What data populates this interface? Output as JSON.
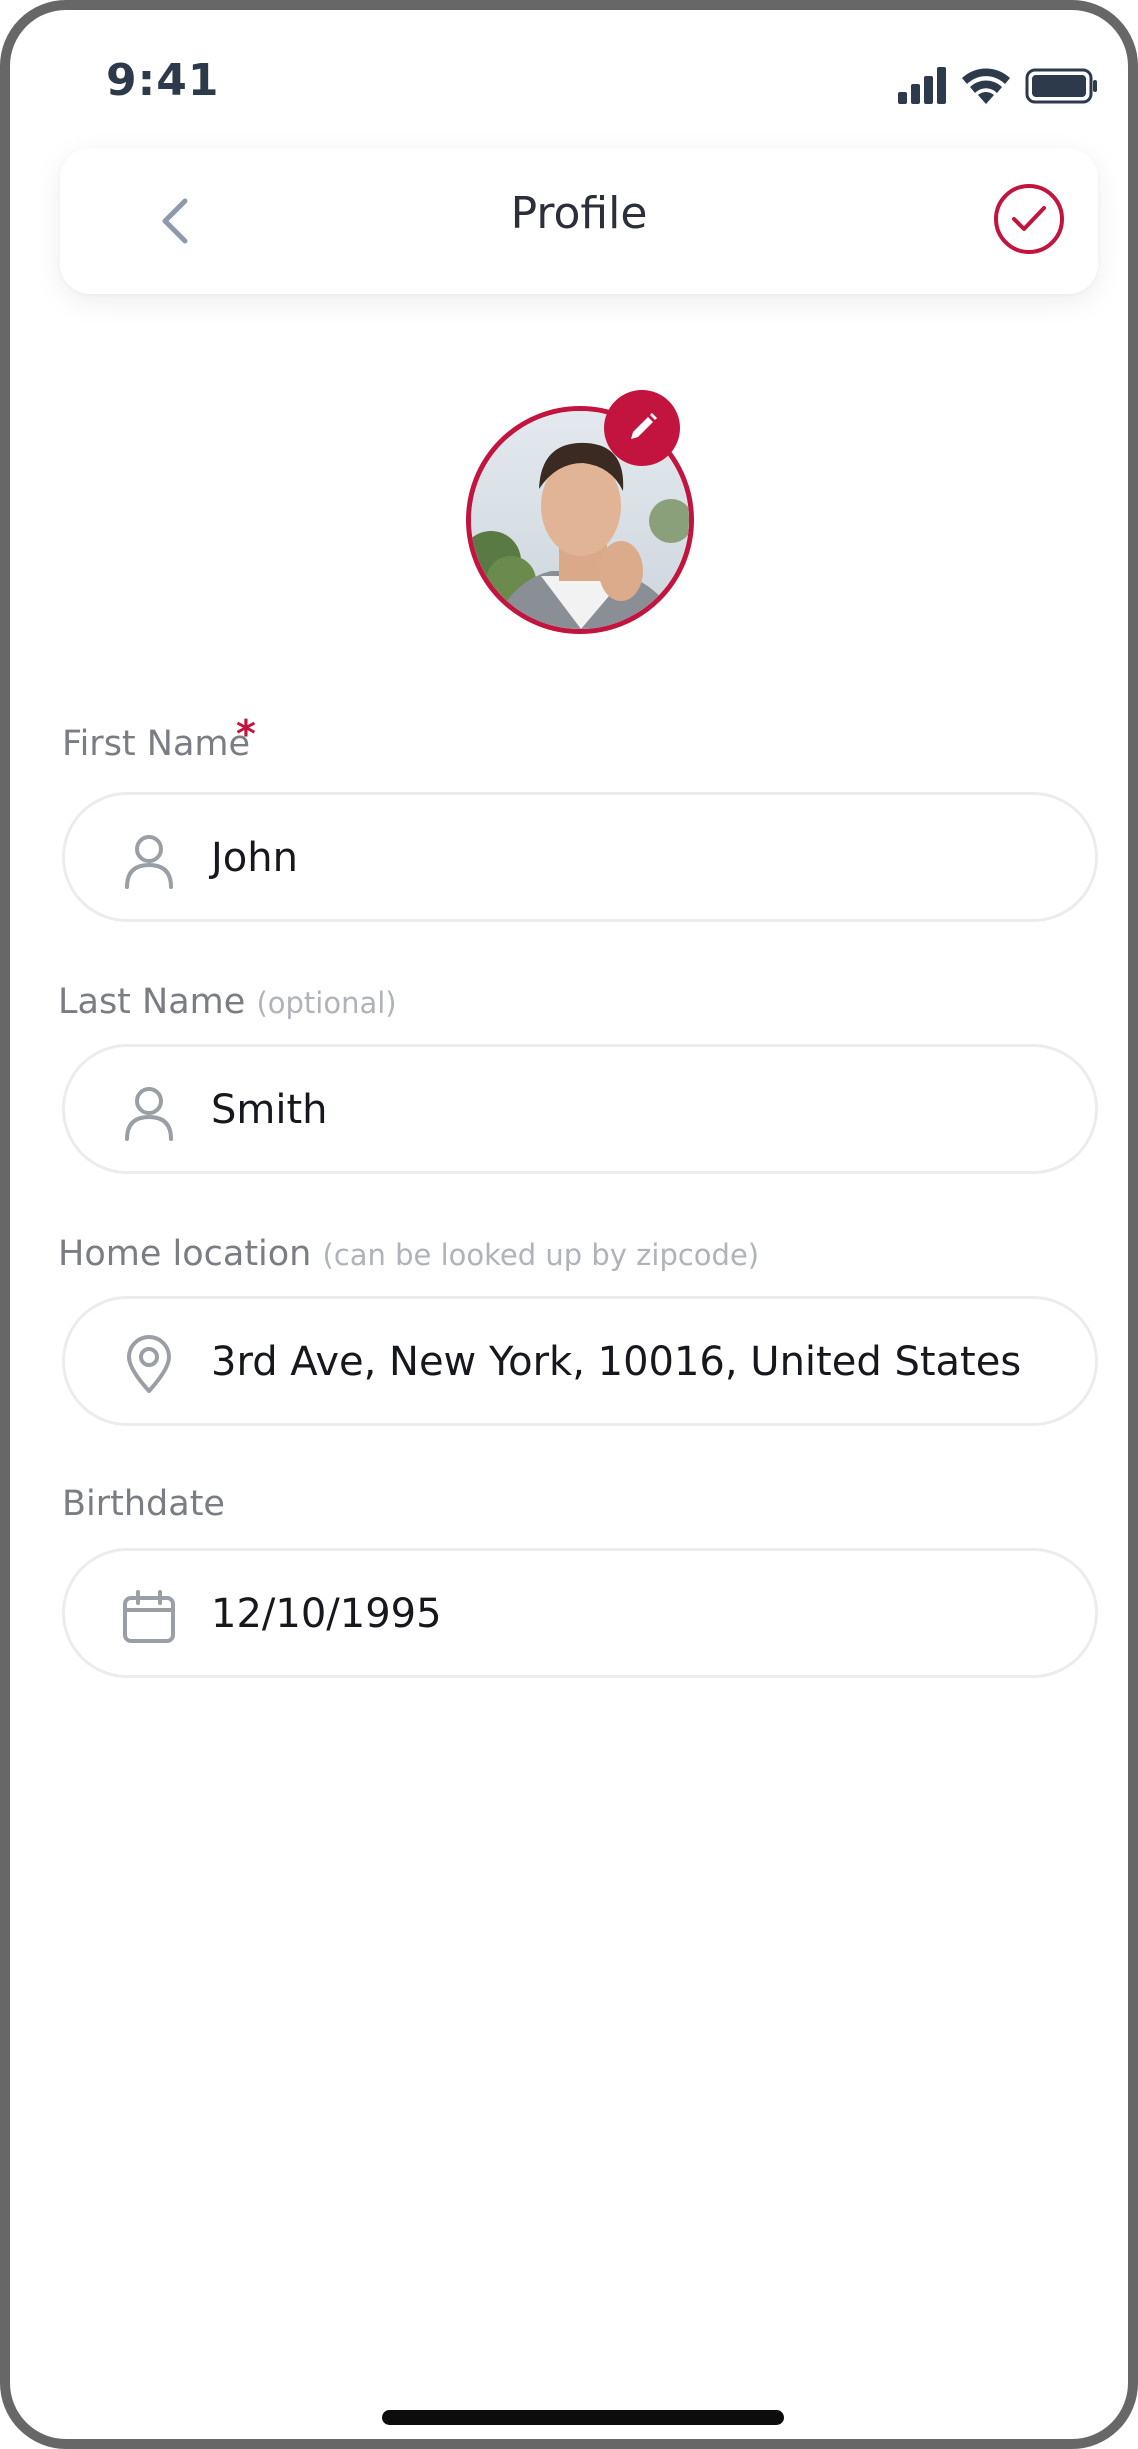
{
  "status_bar": {
    "time": "9:41"
  },
  "header": {
    "title": "Profile",
    "back_icon": "chevron-left-icon",
    "confirm_icon": "check-circle-icon"
  },
  "avatar": {
    "alt": "Profile photo",
    "edit_icon": "pencil-icon"
  },
  "form": {
    "first_name": {
      "label": "First Name",
      "required_mark": "*",
      "value": "John",
      "icon": "user-icon"
    },
    "last_name": {
      "label": "Last Name",
      "hint": "(optional)",
      "value": "Smith",
      "icon": "user-icon"
    },
    "home_location": {
      "label": "Home location",
      "hint": "(can be looked up by zipcode)",
      "value": "3rd Ave, New York, 10016, United States",
      "icon": "location-pin-icon"
    },
    "birthdate": {
      "label": "Birthdate",
      "value": "12/10/1995",
      "icon": "calendar-icon"
    }
  },
  "colors": {
    "accent": "#c2143f",
    "text": "#16181d",
    "label": "#7a7d84",
    "hint": "#b0b3b9",
    "border": "#ececee",
    "frame": "#676767"
  }
}
